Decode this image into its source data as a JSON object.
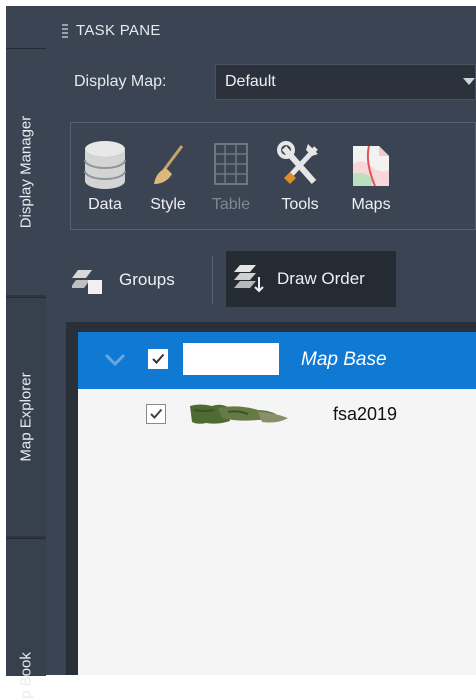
{
  "pane": {
    "title": "TASK PANE"
  },
  "sidebar": {
    "tabs": [
      {
        "label": "Display Manager",
        "active": true
      },
      {
        "label": "Map Explorer",
        "active": false
      },
      {
        "label": "p Book",
        "active": false
      }
    ]
  },
  "display_map": {
    "label": "Display Map:",
    "value": "Default"
  },
  "toolbar": {
    "items": [
      {
        "label": "Data",
        "icon": "database-icon",
        "enabled": true
      },
      {
        "label": "Style",
        "icon": "brush-icon",
        "enabled": true
      },
      {
        "label": "Table",
        "icon": "table-icon",
        "enabled": false
      },
      {
        "label": "Tools",
        "icon": "tools-icon",
        "enabled": true
      },
      {
        "label": "Maps",
        "icon": "map-icon",
        "enabled": true
      }
    ]
  },
  "view_buttons": {
    "groups_label": "Groups",
    "draw_order_label": "Draw Order",
    "draw_order_active": true
  },
  "layers": [
    {
      "name": "Map Base",
      "checked": true,
      "selected": true,
      "expanded": true,
      "italic": true
    },
    {
      "name": "fsa2019",
      "checked": true,
      "selected": false
    }
  ],
  "colors": {
    "panel_bg": "#3b4453",
    "selection": "#0f79d4",
    "tree_bg": "#f5f5f5",
    "text_light": "#eef0f3"
  }
}
